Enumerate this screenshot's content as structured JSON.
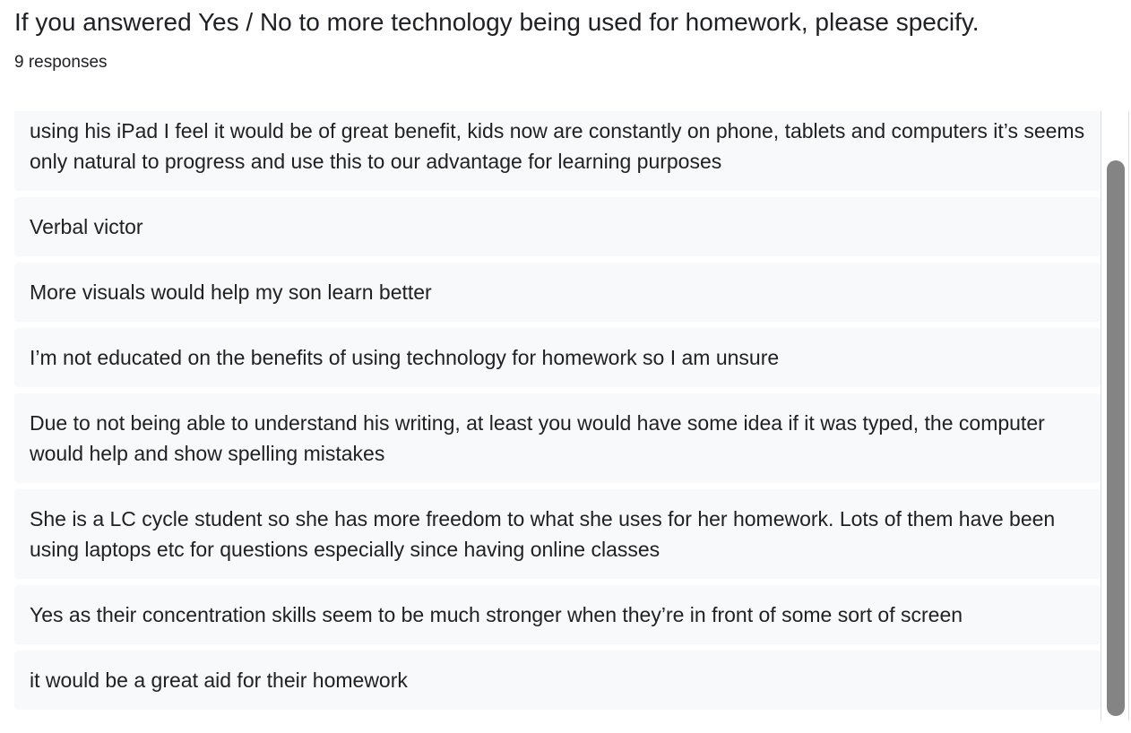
{
  "question": {
    "title": "If you answered Yes / No to more technology being used for homework, please specify.",
    "response_count": "9 responses"
  },
  "responses": [
    "using his iPad I feel it would be of great benefit, kids now are constantly on phone, tablets and computers it’s seems only natural to progress and use this to our advantage for learning purposes",
    "Verbal victor",
    "More visuals would help my son learn better",
    "I’m not educated on the benefits of using technology for homework so I am unsure",
    "Due to not being able to understand his writing, at least you would have some idea if it was typed, the computer would help and show spelling mistakes",
    "She is a LC cycle student so she has more freedom to what she uses for her homework. Lots of them have been using laptops etc for questions especially since having online classes",
    "Yes as their concentration skills seem to be much stronger when they’re in front of some sort of screen",
    "it would be a great aid for their homework"
  ]
}
